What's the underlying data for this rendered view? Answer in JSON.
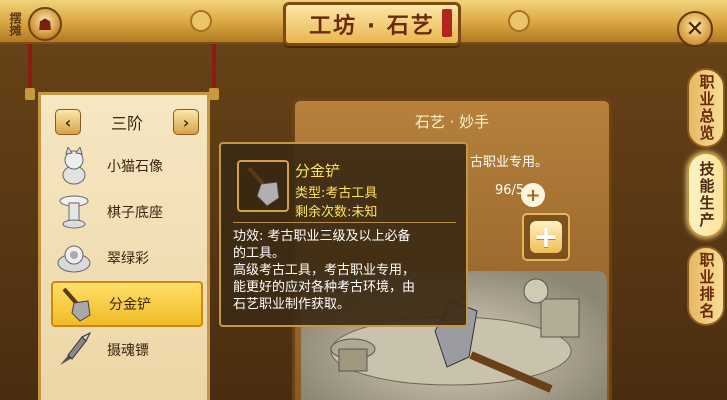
{
  "header": {
    "title": "工坊 · 石艺",
    "stall_label": "摆摊"
  },
  "left_panel": {
    "tier": "三阶",
    "items": [
      {
        "name": "小猫石像",
        "icon": "cat-statue-icon",
        "selected": false
      },
      {
        "name": "棋子底座",
        "icon": "chess-base-icon",
        "selected": false
      },
      {
        "name": "翠绿彩",
        "icon": "jade-ornament-icon",
        "selected": false
      },
      {
        "name": "分金铲",
        "icon": "gold-shovel-icon",
        "selected": true
      },
      {
        "name": "摄魂镖",
        "icon": "soul-dart-icon",
        "selected": false
      }
    ]
  },
  "craft_panel": {
    "header": "石艺 · 妙手",
    "desc_fragment": "古职业专用。",
    "energy": "96/54"
  },
  "tooltip": {
    "item_name": "分金铲",
    "type_line": "类型:考古工具",
    "uses_line": "剩余次数:未知",
    "body": [
      "功效: 考古职业三级及以上必备",
      "的工具。",
      "高级考古工具，考古职业专用，",
      "能更好的应对各种考古环境，由",
      "石艺职业制作获取。"
    ]
  },
  "right_tabs": [
    {
      "label": "职业总览",
      "active": false
    },
    {
      "label": "技能生产",
      "active": true
    },
    {
      "label": "职业排名",
      "active": false
    }
  ],
  "colors": {
    "gold_text": "#ffe55a",
    "selected_item_bg": "#f0bb28",
    "panel_bg": "#ecd6a6"
  }
}
